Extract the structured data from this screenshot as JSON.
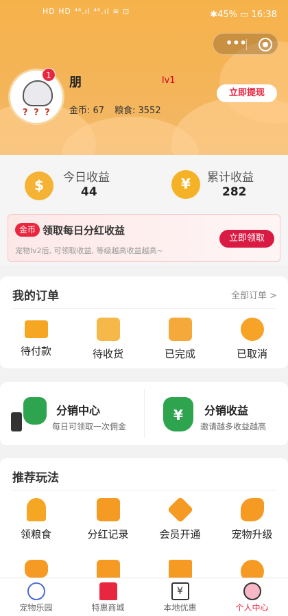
{
  "status_bar": {
    "left": "HD HD ⁴⁶.ıl ⁴⁶.ıl ≋ ⊡",
    "right": "✱45% ▭ 16:38"
  },
  "user": {
    "name": "朋",
    "level": "lv1",
    "badge_count": "1",
    "avatar_marks": "? ? ?",
    "coin_text": "金币: 67",
    "food_text": "粮食: 3552",
    "withdraw_label": "立即提现"
  },
  "earnings": {
    "today_label": "今日收益",
    "today_value": "44",
    "total_label": "累计收益",
    "total_value": "282"
  },
  "dividend": {
    "tag": "金币",
    "title": "领取每日分红收益",
    "subtitle": "宠物lv2后, 可领取收益, 等级越高收益越高~",
    "button": "立即领取"
  },
  "orders": {
    "title": "我的订单",
    "all_label": "全部订单 >",
    "items": [
      {
        "label": "待付款",
        "icon": "wallet-icon"
      },
      {
        "label": "待收货",
        "icon": "bag-icon"
      },
      {
        "label": "已完成",
        "icon": "calendar-check-icon"
      },
      {
        "label": "已取消",
        "icon": "umbrella-icon"
      }
    ]
  },
  "distribution": {
    "center_title": "分销中心",
    "center_sub": "每日可领取一次佣金",
    "income_title": "分销收益",
    "income_sub": "邀请越多收益越高"
  },
  "recommend": {
    "title": "推荐玩法",
    "items": [
      {
        "label": "领粮食",
        "icon": "wheat-icon"
      },
      {
        "label": "分红记录",
        "icon": "red-envelope-icon"
      },
      {
        "label": "会员开通",
        "icon": "diamond-icon"
      },
      {
        "label": "宠物升级",
        "icon": "rocket-icon"
      }
    ],
    "row2_icons": [
      "gamepad-icon",
      "gift-heart-icon",
      "store-icon",
      "user-gear-icon"
    ]
  },
  "tabs": [
    {
      "label": "宠物乐园",
      "icon": "ferris-wheel-icon"
    },
    {
      "label": "特惠商城",
      "icon": "shop-icon"
    },
    {
      "label": "本地优惠",
      "icon": "cash-register-icon"
    },
    {
      "label": "个人中心",
      "icon": "bear-face-icon"
    }
  ],
  "colors": {
    "header": "#f6b24a",
    "accent_red": "#e8263f",
    "icon_orange": "#f59b23"
  }
}
